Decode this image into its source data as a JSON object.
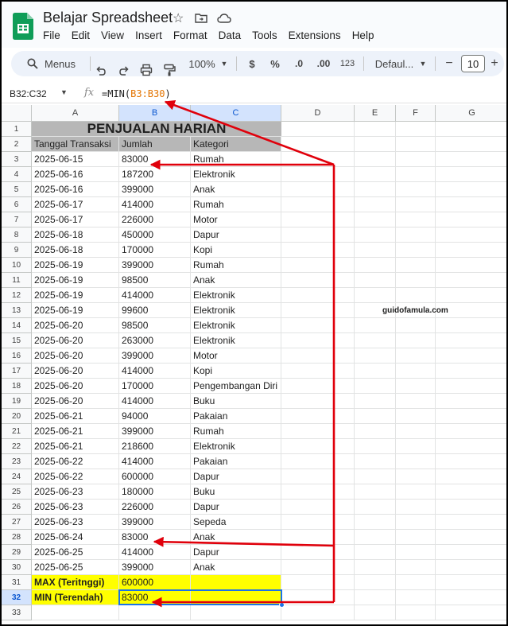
{
  "app": {
    "title": "Belajar Spreadsheet",
    "menus": [
      "File",
      "Edit",
      "View",
      "Insert",
      "Format",
      "Data",
      "Tools",
      "Extensions",
      "Help"
    ]
  },
  "toolbar": {
    "search_label": "Menus",
    "zoom": "100%",
    "currency": "$",
    "percent": "%",
    "decrease_decimal": ".0",
    "increase_decimal": ".00",
    "number_format": "123",
    "font": "Defaul...",
    "minus": "−",
    "font_size": "10",
    "plus": "+"
  },
  "formula_bar": {
    "name_box": "B32:C32",
    "fx": "fx",
    "formula_prefix": "=MIN(",
    "formula_range": "B3:B30",
    "formula_suffix": ")"
  },
  "sheet": {
    "columns": [
      "A",
      "B",
      "C",
      "D",
      "E",
      "F",
      "G"
    ],
    "title": "PENJUALAN HARIAN",
    "headers": [
      "Tanggal Transaksi",
      "Jumlah",
      "Kategori"
    ],
    "rows": [
      [
        "2025-06-15",
        "83000",
        "Rumah"
      ],
      [
        "2025-06-16",
        "187200",
        "Elektronik"
      ],
      [
        "2025-06-16",
        "399000",
        "Anak"
      ],
      [
        "2025-06-17",
        "414000",
        "Rumah"
      ],
      [
        "2025-06-17",
        "226000",
        "Motor"
      ],
      [
        "2025-06-18",
        "450000",
        "Dapur"
      ],
      [
        "2025-06-18",
        "170000",
        "Kopi"
      ],
      [
        "2025-06-19",
        "399000",
        "Rumah"
      ],
      [
        "2025-06-19",
        "98500",
        "Anak"
      ],
      [
        "2025-06-19",
        "414000",
        "Elektronik"
      ],
      [
        "2025-06-19",
        "99600",
        "Elektronik"
      ],
      [
        "2025-06-20",
        "98500",
        "Elektronik"
      ],
      [
        "2025-06-20",
        "263000",
        "Elektronik"
      ],
      [
        "2025-06-20",
        "399000",
        "Motor"
      ],
      [
        "2025-06-20",
        "414000",
        "Kopi"
      ],
      [
        "2025-06-20",
        "170000",
        "Pengembangan Diri"
      ],
      [
        "2025-06-20",
        "414000",
        "Buku"
      ],
      [
        "2025-06-21",
        "94000",
        "Pakaian"
      ],
      [
        "2025-06-21",
        "399000",
        "Rumah"
      ],
      [
        "2025-06-21",
        "218600",
        "Elektronik"
      ],
      [
        "2025-06-22",
        "414000",
        "Pakaian"
      ],
      [
        "2025-06-22",
        "600000",
        "Dapur"
      ],
      [
        "2025-06-23",
        "180000",
        "Buku"
      ],
      [
        "2025-06-23",
        "226000",
        "Dapur"
      ],
      [
        "2025-06-23",
        "399000",
        "Sepeda"
      ],
      [
        "2025-06-24",
        "83000",
        "Anak"
      ],
      [
        "2025-06-25",
        "414000",
        "Dapur"
      ],
      [
        "2025-06-25",
        "399000",
        "Anak"
      ]
    ],
    "max_label": "MAX (Teritnggi)",
    "max_value": "600000",
    "min_label": "MIN (Terendah)",
    "min_value": "83000",
    "watermark": "guidofamula.com"
  },
  "colors": {
    "accent": "#1a73e8",
    "highlight": "#ffff00",
    "title_fill": "#b7b7b7",
    "arrow": "#e0000b"
  }
}
